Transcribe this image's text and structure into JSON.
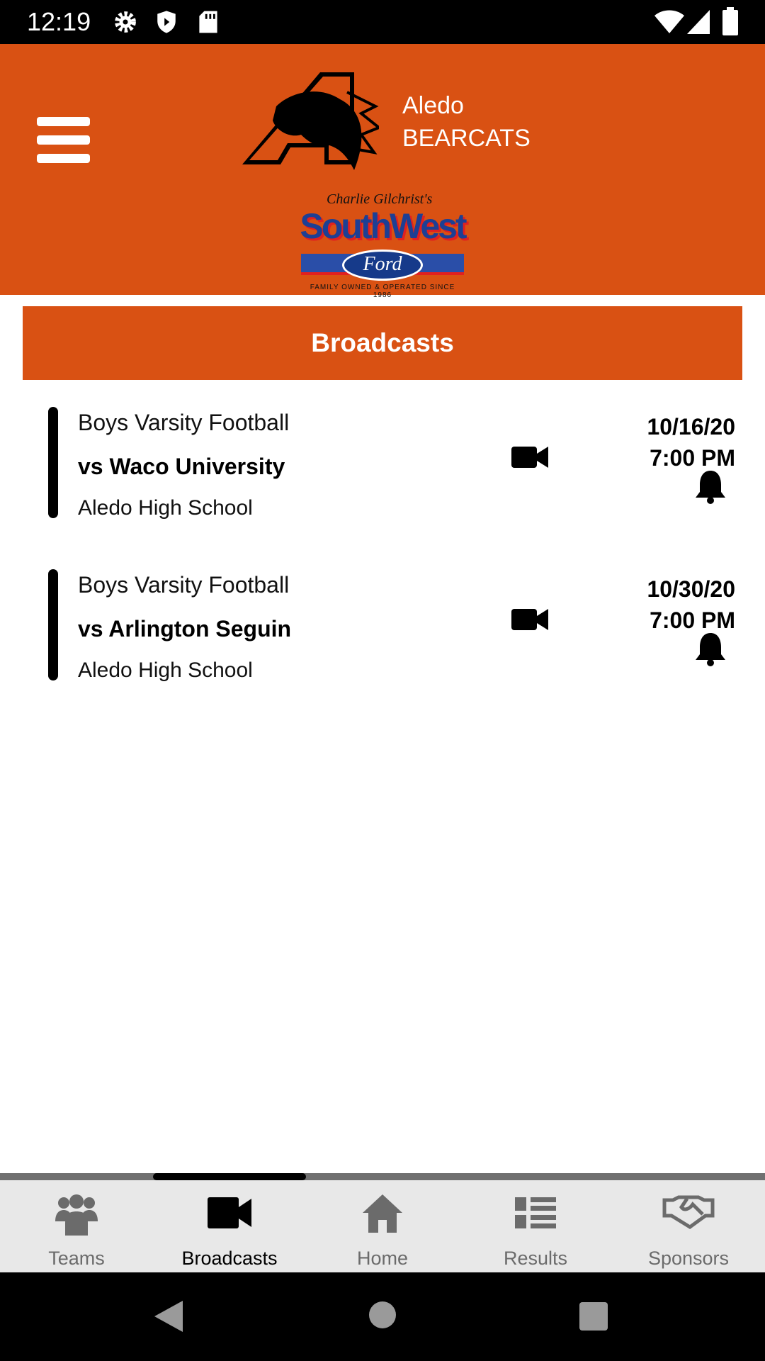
{
  "status_bar": {
    "time": "12:19",
    "icons": [
      "gear-icon",
      "shield-icon",
      "sd-card-icon",
      "wifi-icon",
      "signal-icon",
      "battery-icon"
    ]
  },
  "header": {
    "team_line1": "Aledo",
    "team_line2": "BEARCATS",
    "sponsor_logo_text": "Charlie Gilchrist's SouthWest Ford — Family Owned & Operated Since 1986",
    "brand_color": "#D95113"
  },
  "section_title": "Broadcasts",
  "broadcasts": [
    {
      "sport": "Boys Varsity Football",
      "opponent": "vs Waco University",
      "location": "Aledo High School",
      "date": "10/16/20",
      "time": "7:00 PM"
    },
    {
      "sport": "Boys Varsity Football",
      "opponent": "vs Arlington Seguin",
      "location": "Aledo High School",
      "date": "10/30/20",
      "time": "7:00 PM"
    }
  ],
  "bottom_nav": [
    {
      "label": "Teams",
      "icon": "users-icon"
    },
    {
      "label": "Broadcasts",
      "icon": "video-camera-icon",
      "active": true
    },
    {
      "label": "Home",
      "icon": "home-icon"
    },
    {
      "label": "Results",
      "icon": "list-icon"
    },
    {
      "label": "Sponsors",
      "icon": "handshake-icon"
    }
  ]
}
